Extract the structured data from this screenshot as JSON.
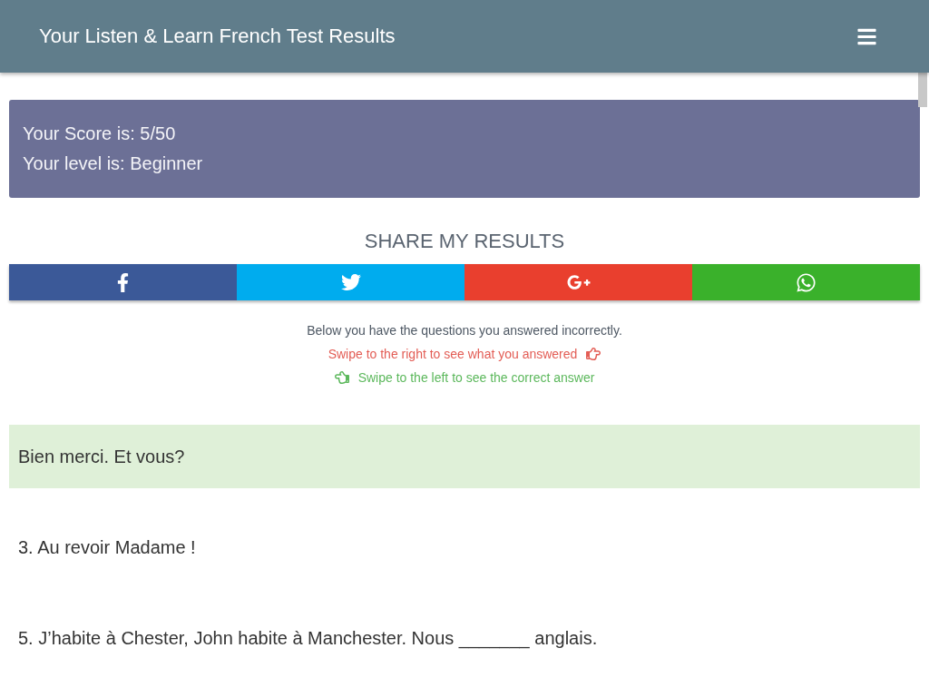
{
  "header": {
    "title": "Your Listen & Learn French Test Results"
  },
  "score_panel": {
    "lines": [
      "Your Score is: 5/50",
      "Your level is: Beginner"
    ]
  },
  "share": {
    "heading": "SHARE MY RESULTS",
    "buttons": [
      {
        "kind": "facebook",
        "color": "#3b5998"
      },
      {
        "kind": "twitter",
        "color": "#00acee"
      },
      {
        "kind": "googleplus",
        "color": "#e93f2e"
      },
      {
        "kind": "whatsapp",
        "color": "#3ab12b"
      }
    ]
  },
  "instructions": [
    {
      "kind": "note",
      "text": "Below you have the questions you answered incorrectly."
    },
    {
      "kind": "swipe_right",
      "text": "Swipe to the right to see what you answered"
    },
    {
      "kind": "swipe_left",
      "text": "Swipe to the left to see the correct answer"
    }
  ],
  "questions": [
    {
      "kind": "correct_answer",
      "text": "Bien merci. Et vous?"
    },
    {
      "kind": "question",
      "text": "3. Au revoir Madame !"
    },
    {
      "kind": "question",
      "text": "5. J’habite à Chester, John habite à Manchester. Nous _______ anglais."
    }
  ]
}
